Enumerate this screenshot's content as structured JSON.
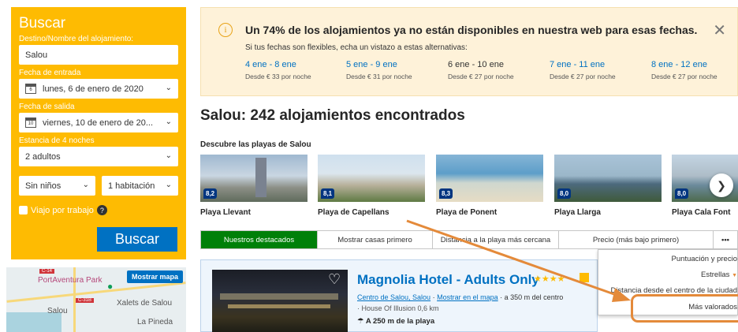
{
  "search": {
    "title": "Buscar",
    "destination_label": "Destino/Nombre del alojamiento:",
    "destination_value": "Salou",
    "checkin_label": "Fecha de entrada",
    "checkin_cal_num": "6",
    "checkin_value": "lunes, 6 de enero de 2020",
    "checkout_label": "Fecha de salida",
    "checkout_cal_num": "10",
    "checkout_value": "viernes, 10 de enero de 20...",
    "stay_label": "Estancia de 4 noches",
    "adults_value": "2 adultos",
    "children_value": "Sin niños",
    "rooms_value": "1 habitación",
    "work_trip_label": "Viajo por trabajo",
    "button_label": "Buscar"
  },
  "map": {
    "button_label": "Mostrar mapa",
    "labels": [
      "PortAventura Park",
      "Xalets de Salou",
      "Salou",
      "La Pineda"
    ],
    "tag1": "C-14",
    "tag2": "C-31B"
  },
  "alert": {
    "title": "Un 74% de los alojamientos ya no están disponibles en nuestra web para esas fechas.",
    "subtitle": "Si tus fechas son flexibles, echa un vistazo a estas alternativas:",
    "alternatives": [
      {
        "dates": "4 ene - 8 ene",
        "price": "Desde € 33 por noche"
      },
      {
        "dates": "5 ene - 9 ene",
        "price": "Desde € 31 por noche"
      },
      {
        "dates": "6 ene - 10 ene",
        "price": "Desde € 27 por noche"
      },
      {
        "dates": "7 ene - 11 ene",
        "price": "Desde € 27 por noche"
      },
      {
        "dates": "8 ene - 12 ene",
        "price": "Desde € 27 por noche"
      }
    ]
  },
  "results": {
    "title": "Salou: 242 alojamientos encontrados",
    "beaches_title": "Descubre las playas de Salou",
    "beaches": [
      {
        "name": "Playa Llevant",
        "score": "8,2"
      },
      {
        "name": "Playa de Capellans",
        "score": "8,1"
      },
      {
        "name": "Playa de Ponent",
        "score": "8,3"
      },
      {
        "name": "Playa Llarga",
        "score": "8,0"
      },
      {
        "name": "Playa Cala Font",
        "score": "8,0"
      }
    ]
  },
  "sort_tabs": [
    "Nuestros destacados",
    "Mostrar casas primero",
    "Distancia a la playa más cercana",
    "Precio (más bajo primero)",
    "•••"
  ],
  "sort_dropdown": [
    "Puntuación y precio",
    "Estrellas",
    "Distancia desde el centro de la ciudad",
    "Más valorados"
  ],
  "hotel": {
    "name": "Magnolia Hotel - Adults Only",
    "stars": "★★★★",
    "location_link": "Centro de Salou, Salou",
    "map_link": "Mostrar en el mapa",
    "distance": "· a 350 m del centro",
    "nearby": "· House Of Illusion 0,6 km",
    "beach_distance": "A 250 m de la playa"
  },
  "colors": {
    "brand_yellow": "#febb02",
    "brand_blue": "#0071c2",
    "active_tab_green": "#008009",
    "annotation_orange": "#e48a3a"
  }
}
